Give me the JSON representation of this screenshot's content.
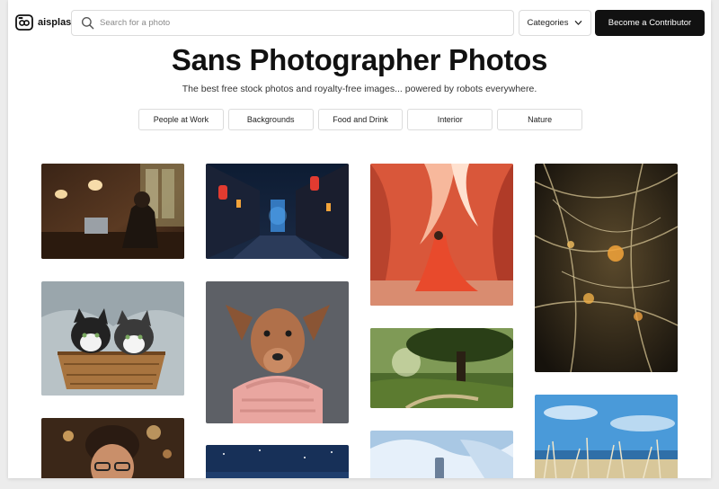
{
  "header": {
    "logo_text": "aisplash",
    "search_placeholder": "Search for a photo",
    "categories_label": "Categories",
    "contributor_label": "Become a Contributor"
  },
  "hero": {
    "title": "Sans Photographer Photos",
    "subtitle": "The best free stock photos and royalty-free images... powered by robots everywhere."
  },
  "chips": [
    "People at Work",
    "Backgrounds",
    "Food and Drink",
    "Interior",
    "Nature"
  ],
  "colors": {
    "accent": "#111111",
    "border": "#dcdcdc",
    "background": "#ffffff"
  },
  "icons": {
    "logo": "camera-logo-icon",
    "search": "search-icon",
    "categories": "chevron-down-icon"
  }
}
